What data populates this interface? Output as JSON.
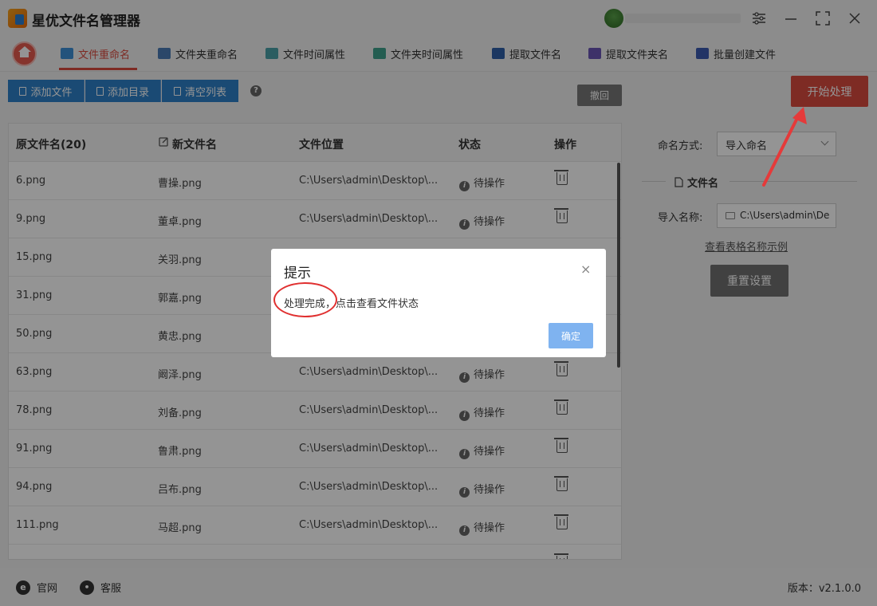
{
  "app": {
    "title": "星优文件名管理器"
  },
  "nav": {
    "tabs": [
      {
        "label": "文件重命名",
        "active": true
      },
      {
        "label": "文件夹重命名"
      },
      {
        "label": "文件时间属性"
      },
      {
        "label": "文件夹时间属性"
      },
      {
        "label": "提取文件名"
      },
      {
        "label": "提取文件夹名"
      },
      {
        "label": "批量创建文件"
      }
    ]
  },
  "toolbar": {
    "add_file": "添加文件",
    "add_dir": "添加目录",
    "clear_list": "清空列表",
    "help": "?",
    "undo": "撤回",
    "start": "开始处理"
  },
  "table": {
    "headers": {
      "original": "原文件名(20)",
      "new": "新文件名",
      "location": "文件位置",
      "status": "状态",
      "action": "操作"
    },
    "rows": [
      {
        "original": "6.png",
        "new": "曹操.png",
        "location": "C:\\Users\\admin\\Desktop\\...",
        "status": "待操作"
      },
      {
        "original": "9.png",
        "new": "董卓.png",
        "location": "C:\\Users\\admin\\Desktop\\...",
        "status": "待操作"
      },
      {
        "original": "15.png",
        "new": "关羽.png",
        "location": "",
        "status": ""
      },
      {
        "original": "31.png",
        "new": "郭嘉.png",
        "location": "",
        "status": ""
      },
      {
        "original": "50.png",
        "new": "黄忠.png",
        "location": "",
        "status": ""
      },
      {
        "original": "63.png",
        "new": "阚泽.png",
        "location": "C:\\Users\\admin\\Desktop\\...",
        "status": "待操作"
      },
      {
        "original": "78.png",
        "new": "刘备.png",
        "location": "C:\\Users\\admin\\Desktop\\...",
        "status": "待操作"
      },
      {
        "original": "91.png",
        "new": "鲁肃.png",
        "location": "C:\\Users\\admin\\Desktop\\...",
        "status": "待操作"
      },
      {
        "original": "94.png",
        "new": "吕布.png",
        "location": "C:\\Users\\admin\\Desktop\\...",
        "status": "待操作"
      },
      {
        "original": "111.png",
        "new": "马超.png",
        "location": "C:\\Users\\admin\\Desktop\\...",
        "status": "待操作"
      }
    ]
  },
  "settings": {
    "naming_label": "命名方式:",
    "naming_value": "导入命名",
    "section_title": "文件名",
    "import_label": "导入名称:",
    "import_value": "C:\\Users\\admin\\De",
    "example_link": "查看表格名称示例",
    "reset": "重置设置"
  },
  "dialog": {
    "title": "提示",
    "close": "×",
    "message": "处理完成，点击查看文件状态",
    "ok": "确定"
  },
  "footer": {
    "website": "官网",
    "service": "客服",
    "version": "版本：v2.1.0.0"
  },
  "colors": {
    "accent": "#d94a3f",
    "toolbar_blue": "#2e80c8",
    "annotation_red": "#e03030"
  }
}
